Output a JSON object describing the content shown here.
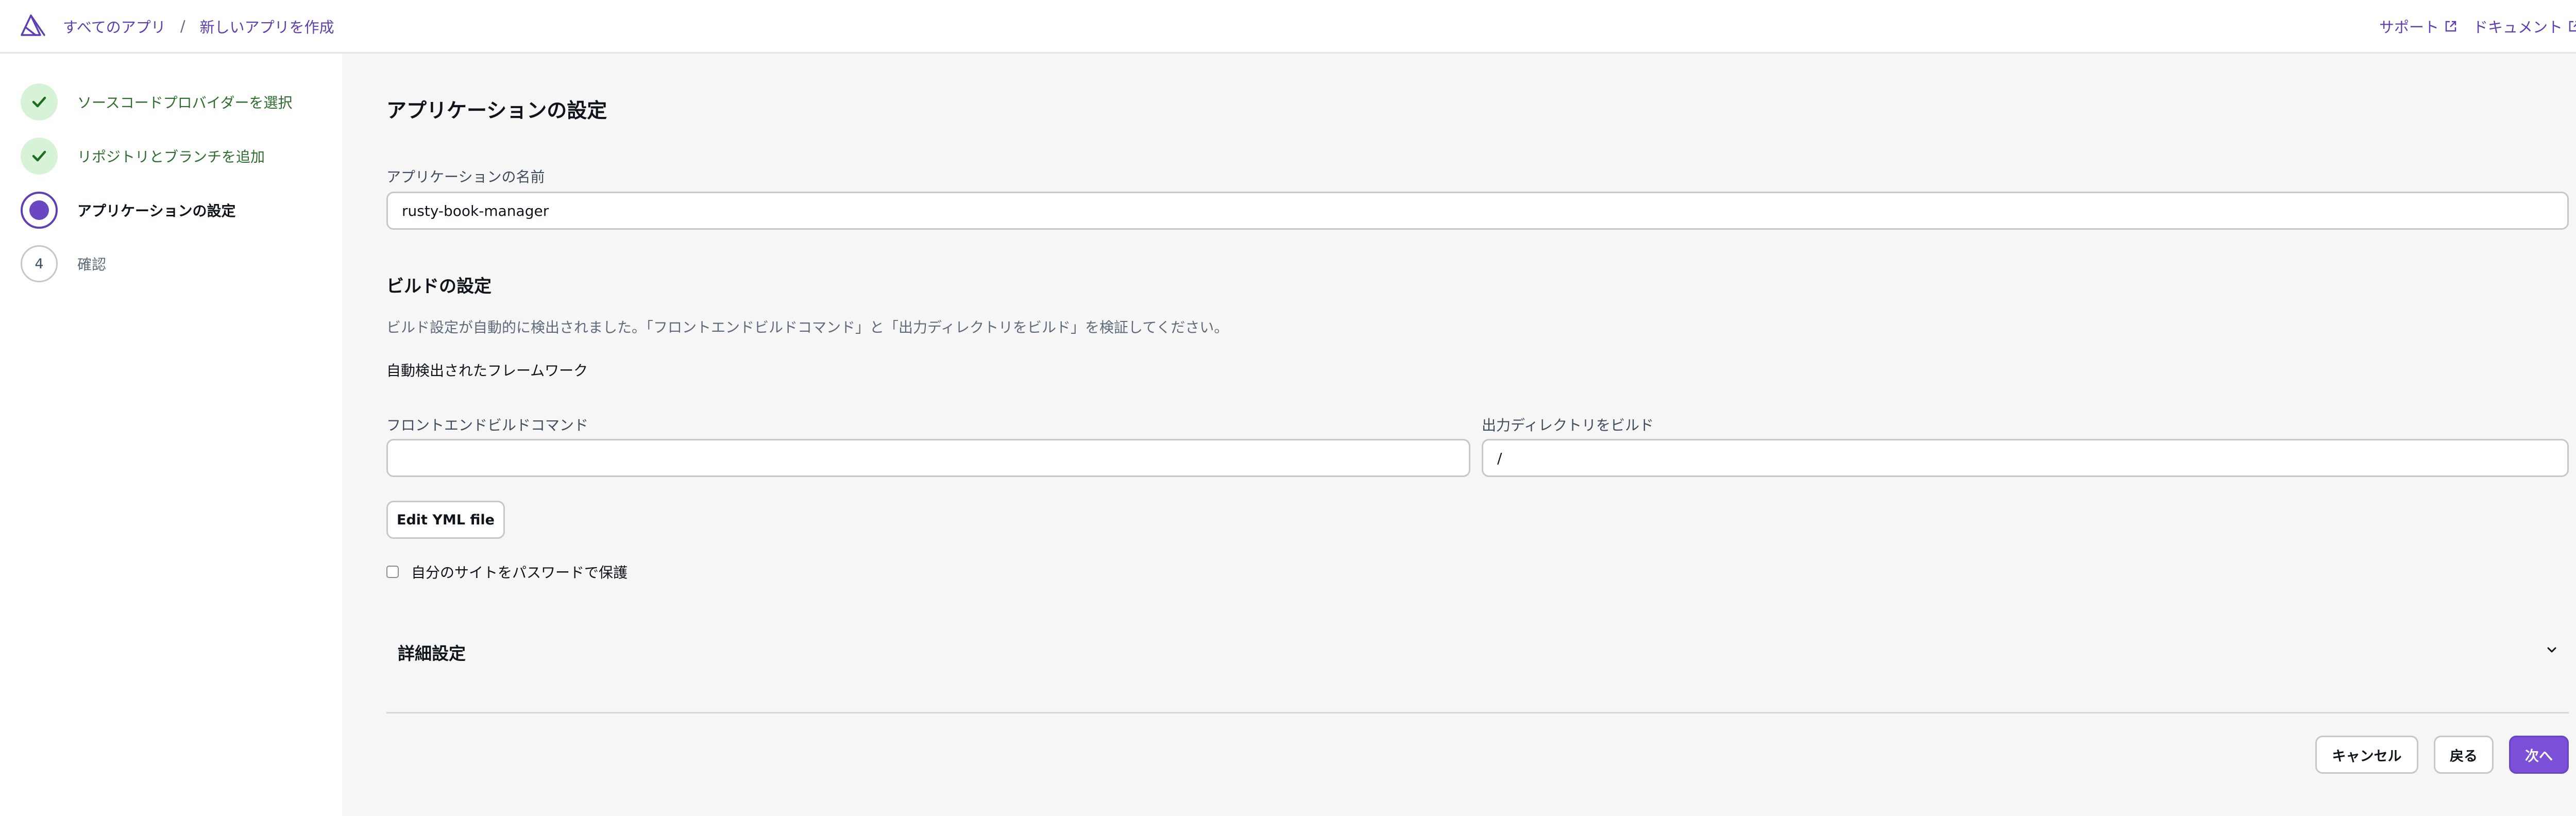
{
  "header": {
    "breadcrumbs": [
      "すべてのアプリ",
      "新しいアプリを作成"
    ],
    "separator": "/",
    "links": [
      {
        "label": "サポート",
        "icon": "external-link-icon"
      },
      {
        "label": "ドキュメント",
        "icon": "external-link-icon"
      }
    ]
  },
  "steps": [
    {
      "label": "ソースコードプロバイダーを選択",
      "state": "completed",
      "icon": "check-icon"
    },
    {
      "label": "リポジトリとブランチを追加",
      "state": "completed",
      "icon": "check-icon"
    },
    {
      "label": "アプリケーションの設定",
      "state": "current"
    },
    {
      "number": "4",
      "label": "確認",
      "state": "pending"
    }
  ],
  "main": {
    "title": "アプリケーションの設定",
    "app_name": {
      "label": "アプリケーションの名前",
      "value": "rusty-book-manager"
    },
    "build": {
      "title": "ビルドの設定",
      "description": "ビルド設定が自動的に検出されました。「フロントエンドビルドコマンド」と「出力ディレクトリをビルド」を検証してください。",
      "framework_label": "自動検出されたフレームワーク",
      "frontend_command": {
        "label": "フロントエンドビルドコマンド",
        "value": ""
      },
      "output_dir": {
        "label": "出力ディレクトリをビルド",
        "value": "/"
      },
      "edit_yml_label": "Edit YML file"
    },
    "password_protect": {
      "label": "自分のサイトをパスワードで保護",
      "checked": false
    },
    "advanced": {
      "title": "詳細設定",
      "expanded": false
    }
  },
  "footer": {
    "cancel_label": "キャンセル",
    "back_label": "戻る",
    "next_label": "次へ"
  },
  "colors": {
    "accent": "#5f3fb4",
    "primary_button": "#7b4fd6",
    "completed_step_bg": "#d7f3d7",
    "completed_step_check": "#1d6f1d"
  }
}
